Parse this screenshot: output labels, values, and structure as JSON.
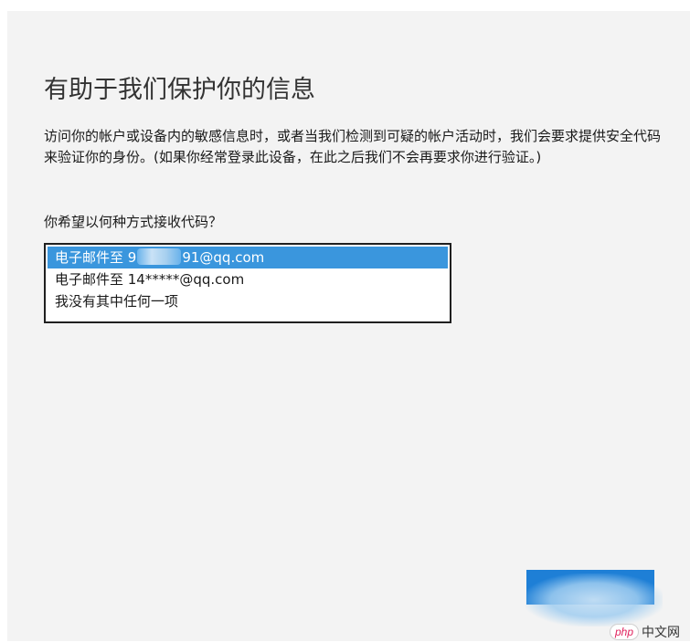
{
  "page": {
    "title": "有助于我们保护你的信息",
    "description": "访问你的帐户或设备内的敏感信息时，或者当我们检测到可疑的帐户活动时，我们会要求提供安全代码来验证你的身份。(如果你经常登录此设备，在此之后我们不会再要求你进行验证。)",
    "question": "你希望以何种方式接收代码？"
  },
  "options": [
    {
      "prefix": "电子邮件至 9",
      "suffix": "91@qq.com",
      "selected": true,
      "masked": true
    },
    {
      "text": "电子邮件至 14*****@qq.com",
      "selected": false
    },
    {
      "text": "我没有其中任何一项",
      "selected": false
    }
  ],
  "colors": {
    "background": "#f3f3f3",
    "selection": "#3a96dd",
    "button": "#1e7fd6"
  },
  "watermark": {
    "logo": "php",
    "text": "中文网"
  }
}
